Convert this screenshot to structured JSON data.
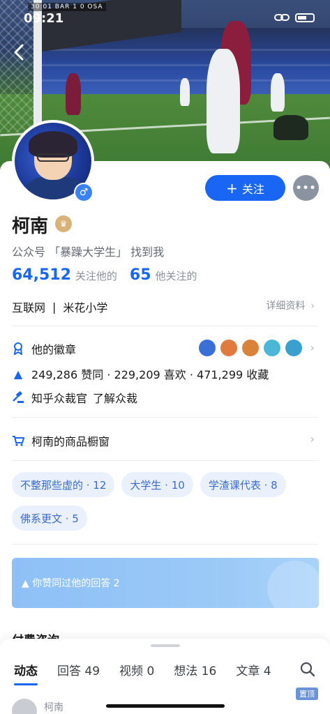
{
  "status": {
    "time": "09:21",
    "score": "30:01 BAR 1 0 OSA"
  },
  "profile": {
    "name": "柯南",
    "wechat_text": "公众号 「暴躁大学生」 找到我",
    "followers_count": "64,512",
    "followers_label": "关注他的",
    "following_count": "65",
    "following_label": "他关注的",
    "industry": "互联网",
    "separator": "|",
    "school": "米花小学",
    "detail_link": "详细资料"
  },
  "actions": {
    "follow_label": "关注",
    "follow_plus": "+",
    "message_icon": "•••"
  },
  "achievements": {
    "badges_label": "他的徽章",
    "stats_text": "249,286 赞同 · 229,209 喜欢 · 471,299 收藏",
    "jury_label": "知乎众裁官",
    "jury_link": "了解众裁",
    "medal_colors": [
      "#3a6fd8",
      "#e07a3f",
      "#d9823a",
      "#4cb8d8",
      "#3aa0d0"
    ]
  },
  "shop": {
    "label": "柯南的商品橱窗"
  },
  "tags": [
    "不整那些虚的 · 12",
    "大学生 · 10",
    "学渣课代表 · 8",
    "佛系更文 · 5"
  ],
  "banner": {
    "text": "你赞同过他的回答 2",
    "icon": "▲"
  },
  "section": {
    "paid_title": "付费咨询"
  },
  "tabs": [
    "动态",
    "回答 49",
    "视频 0",
    "想法 16",
    "文章 4"
  ],
  "feed": {
    "name": "柯南",
    "pin_label": "置顶"
  },
  "colors": {
    "accent": "#1966f5",
    "tag_bg": "#eaf1fc",
    "tag_text": "#3b6bc9"
  }
}
